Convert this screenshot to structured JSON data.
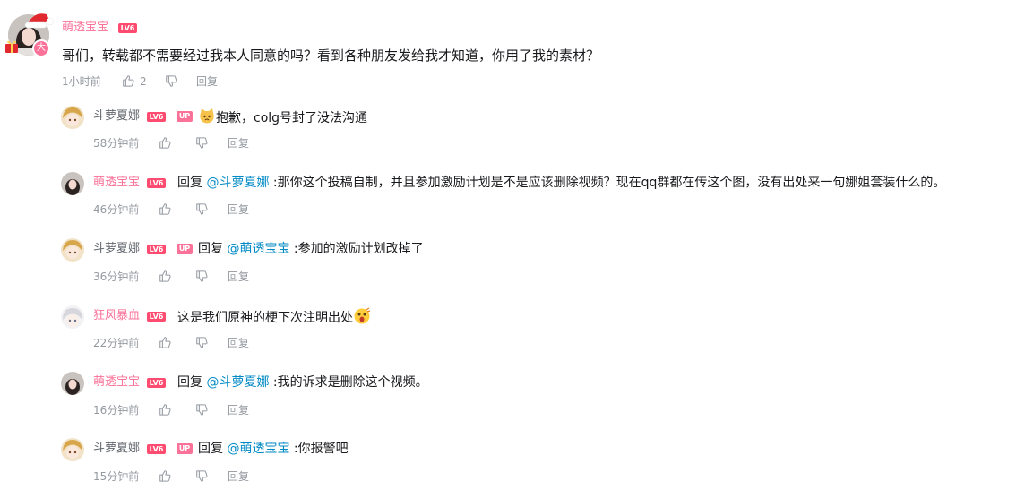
{
  "main_comment": {
    "user": "萌透宝宝",
    "level": "LV6",
    "badge_char": "大",
    "text": "哥们，转载都不需要经过我本人同意的吗？看到各种朋友发给我才知道，你用了我的素材？",
    "time": "1小时前",
    "likes": "2",
    "reply_label": "回复"
  },
  "replies": [
    {
      "user": "斗萝夏娜",
      "level": "LV6",
      "up": "UP",
      "prefix": "",
      "at": "",
      "text": "抱歉，colg号封了没法沟通",
      "time": "58分钟前",
      "reply_label": "回复",
      "emoji": "cat-emoji-icon"
    },
    {
      "user": "萌透宝宝",
      "level": "LV6",
      "prefix": "回复 ",
      "at": "@斗萝夏娜",
      "text": " :那你这个投稿自制，并且参加激励计划是不是应该删除视频？现在qq群都在传这个图，没有出处来一句娜姐套装什么的。",
      "time": "46分钟前",
      "reply_label": "回复"
    },
    {
      "user": "斗萝夏娜",
      "level": "LV6",
      "up": "UP",
      "prefix": "回复 ",
      "at": "@萌透宝宝",
      "text": " :参加的激励计划改掉了",
      "time": "36分钟前",
      "reply_label": "回复"
    },
    {
      "user": "狂风暴血",
      "level": "LV6",
      "prefix": "",
      "at": "",
      "text": "这是我们原神的梗下次注明出处",
      "time": "22分钟前",
      "reply_label": "回复",
      "emoji": "surprised-emoji-icon"
    },
    {
      "user": "萌透宝宝",
      "level": "LV6",
      "prefix": "回复 ",
      "at": "@斗萝夏娜",
      "text": " :我的诉求是删除这个视频。",
      "time": "16分钟前",
      "reply_label": "回复"
    },
    {
      "user": "斗萝夏娜",
      "level": "LV6",
      "up": "UP",
      "prefix": "回复 ",
      "at": "@萌透宝宝",
      "text": " :你报警吧",
      "time": "15分钟前",
      "reply_label": "回复"
    }
  ],
  "colors": {
    "pink_name": "#fb7299",
    "at_link": "#008ac5",
    "meta": "#9499a0",
    "level_badge": "#fe4b6f"
  }
}
